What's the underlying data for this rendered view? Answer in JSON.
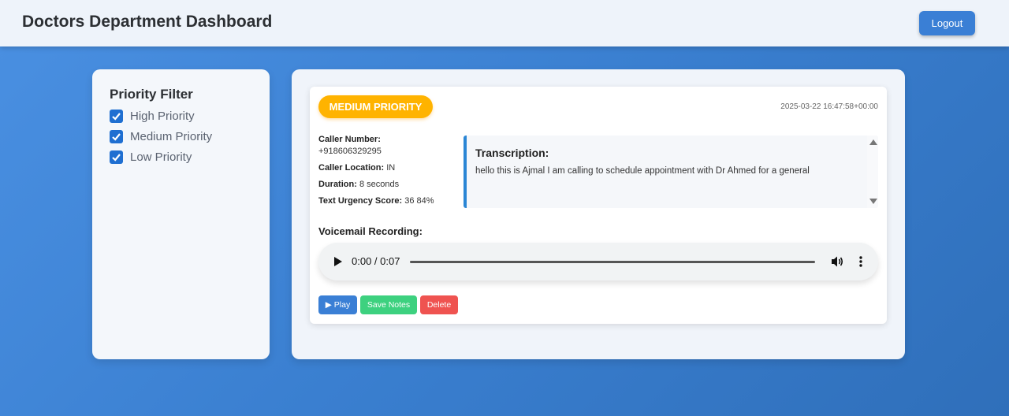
{
  "header": {
    "title": "Doctors Department Dashboard",
    "logout_label": "Logout"
  },
  "sidebar": {
    "title": "Priority Filter",
    "filters": [
      {
        "label": "High Priority",
        "checked": true
      },
      {
        "label": "Medium Priority",
        "checked": true
      },
      {
        "label": "Low Priority",
        "checked": true
      }
    ]
  },
  "call": {
    "priority_badge": "MEDIUM PRIORITY",
    "timestamp": "2025-03-22 16:47:58+00:00",
    "caller_number_label": "Caller Number:",
    "caller_number": "+918606329295",
    "caller_location_label": "Caller Location:",
    "caller_location": "IN",
    "duration_label": "Duration:",
    "duration": "8 seconds",
    "urgency_label": "Text Urgency Score:",
    "urgency": "36 84%",
    "transcription_title": "Transcription:",
    "transcription_text": "hello this is Ajmal I am calling to schedule appointment with Dr Ahmed for a general",
    "voicemail_title": "Voicemail Recording:",
    "player_time": "0:00 / 0:07",
    "play_label": "▶ Play",
    "save_notes_label": "Save Notes",
    "delete_label": "Delete"
  },
  "colors": {
    "accent": "#3a7fd5",
    "medium_priority": "#ffb300",
    "save": "#3dd17f",
    "delete": "#ef5350"
  },
  "icons": {
    "checkbox": "check-icon",
    "player_play": "play-icon",
    "volume": "volume-icon",
    "more": "more-vertical-icon"
  }
}
